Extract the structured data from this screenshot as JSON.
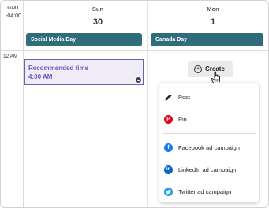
{
  "timezone": {
    "line1": "GMT",
    "line2": "-04:00"
  },
  "days": [
    {
      "name": "Sun",
      "number": "30",
      "all_day_event": "Social Media Day"
    },
    {
      "name": "Mon",
      "number": "1",
      "all_day_event": "Canada Day"
    }
  ],
  "hour_label": "12 AM",
  "recommended": {
    "title": "Recommended time",
    "time": "4:00 AM"
  },
  "create_button": {
    "label": "Create"
  },
  "create_menu": {
    "items": [
      {
        "label": "Post",
        "icon": "pencil-icon"
      },
      {
        "label": "Pin",
        "icon": "pinterest-icon"
      },
      {
        "label": "Facebook ad campaign",
        "icon": "facebook-icon"
      },
      {
        "label": "LinkedIn ad campaign",
        "icon": "linkedin-icon"
      },
      {
        "label": "Twitter ad campaign",
        "icon": "twitter-icon"
      }
    ]
  },
  "colors": {
    "event_bg": "#2f6d7c",
    "recommended_accent": "#6a57b8",
    "recommended_bg": "#efecf6",
    "pinterest": "#e60023",
    "facebook": "#1877f2",
    "linkedin": "#0a66c2",
    "twitter": "#1d9bf0"
  }
}
